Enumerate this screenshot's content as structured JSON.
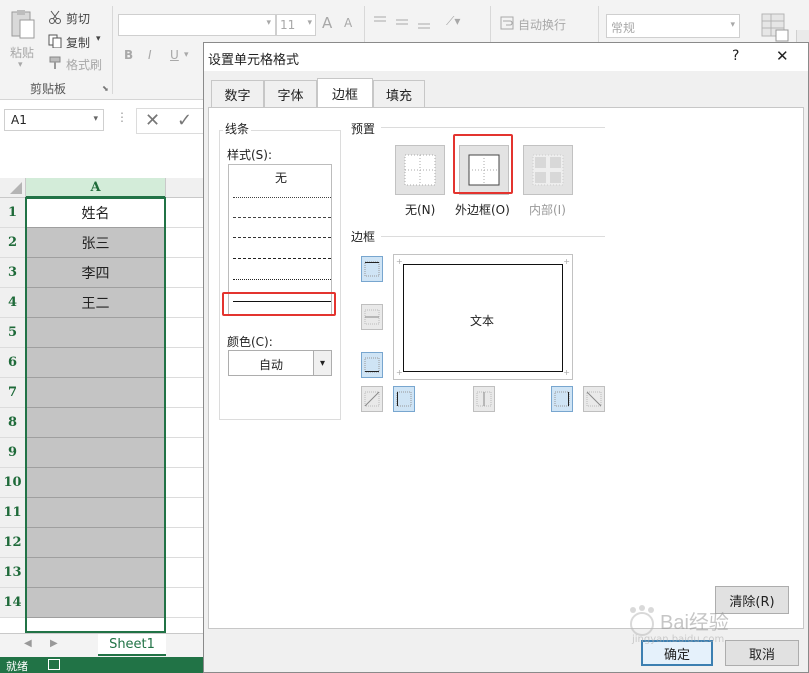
{
  "ribbon": {
    "paste_label": "粘贴",
    "cut_label": "剪切",
    "copy_label": "复制",
    "format_painter_label": "格式刷",
    "clipboard_group": "剪贴板",
    "font_size": "11",
    "bold": "B",
    "italic": "I",
    "underline": "U",
    "grow_font": "A",
    "shrink_font": "A",
    "wrap_text": "自动换行",
    "number_format": "常规"
  },
  "formula_bar": {
    "name_box": "A1"
  },
  "sheet": {
    "column_header": "A",
    "rows": [
      {
        "num": "1",
        "value": "姓名"
      },
      {
        "num": "2",
        "value": "张三"
      },
      {
        "num": "3",
        "value": "李四"
      },
      {
        "num": "4",
        "value": "王二"
      },
      {
        "num": "5",
        "value": ""
      },
      {
        "num": "6",
        "value": ""
      },
      {
        "num": "7",
        "value": ""
      },
      {
        "num": "8",
        "value": ""
      },
      {
        "num": "9",
        "value": ""
      },
      {
        "num": "10",
        "value": ""
      },
      {
        "num": "11",
        "value": ""
      },
      {
        "num": "12",
        "value": ""
      },
      {
        "num": "13",
        "value": ""
      },
      {
        "num": "14",
        "value": ""
      }
    ],
    "tab_name": "Sheet1",
    "status_text": "就绪"
  },
  "dialog": {
    "title": "设置单元格格式",
    "help": "?",
    "close": "✕",
    "tabs": [
      "数字",
      "字体",
      "边框",
      "填充"
    ],
    "active_tab": "边框",
    "line_group": "线条",
    "style_label": "样式(S):",
    "style_none": "无",
    "color_label": "颜色(C):",
    "color_value": "自动",
    "presets_group": "预置",
    "preset_none": "无(N)",
    "preset_outline": "外边框(O)",
    "preset_inside": "内部(I)",
    "border_group": "边框",
    "preview_text": "文本",
    "clear_button": "清除(R)",
    "ok_button": "确定",
    "cancel_button": "取消"
  },
  "watermark": {
    "text": "Bai经验",
    "url": "jingyan.baidu.com"
  }
}
